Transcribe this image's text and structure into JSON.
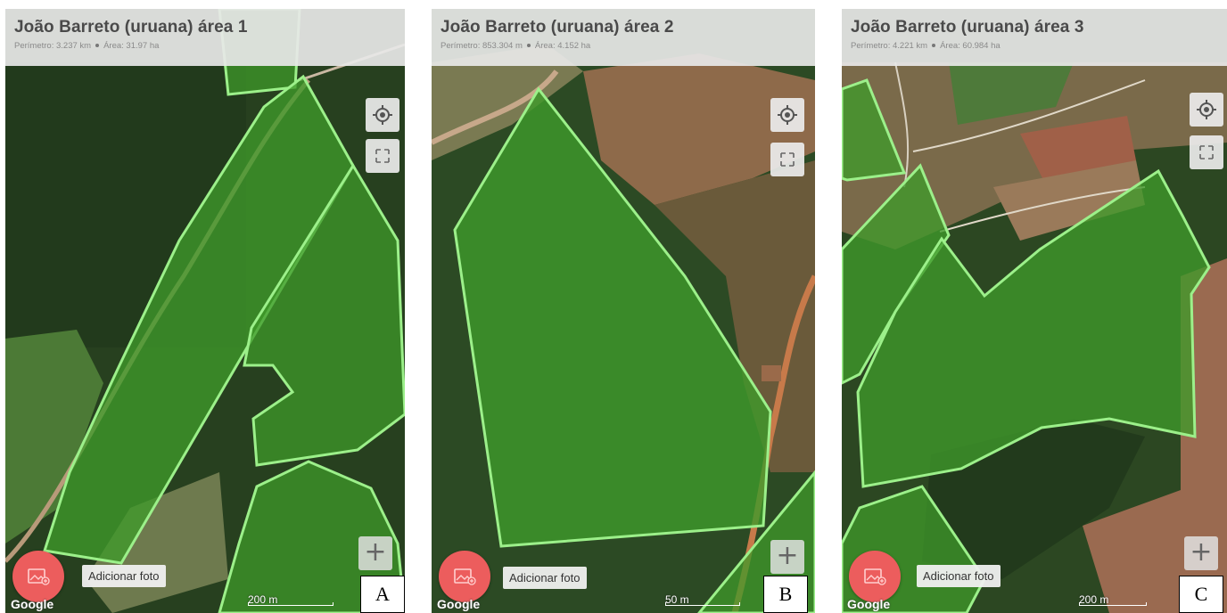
{
  "panels": [
    {
      "id": "A",
      "header": {
        "title": "João Barreto (uruana) área 1",
        "perimeter": "Perímetro: 3.237 km",
        "area": "Área: 31.97 ha"
      },
      "add_photo_label": "Adicionar foto",
      "scale_label": "200 m",
      "google_label": "Google",
      "zoom_label": "+",
      "figure_letter": "A"
    },
    {
      "id": "B",
      "header": {
        "title": "João Barreto (uruana) área 2",
        "perimeter": "Perímetro: 853.304 m",
        "area": "Área: 4.152 ha"
      },
      "add_photo_label": "Adicionar foto",
      "scale_label": "50 m",
      "google_label": "Google",
      "zoom_label": "+",
      "figure_letter": "B"
    },
    {
      "id": "C",
      "header": {
        "title": "João Barreto (uruana) área 3",
        "perimeter": "Perímetro: 4.221 km",
        "area": "Área: 60.984 ha"
      },
      "add_photo_label": "Adicionar foto",
      "scale_label": "200 m",
      "google_label": "Google",
      "zoom_label": "+",
      "figure_letter": "C"
    }
  ],
  "icons": {
    "location": "my-location-icon",
    "fullscreen": "fullscreen-icon",
    "add_photo": "add-photo-icon"
  },
  "colors": {
    "polygon_fill": "#3f9a2a",
    "polygon_stroke": "#9cf08a",
    "fab": "#ec5d5d",
    "header_bg": "#e8e8e8"
  }
}
